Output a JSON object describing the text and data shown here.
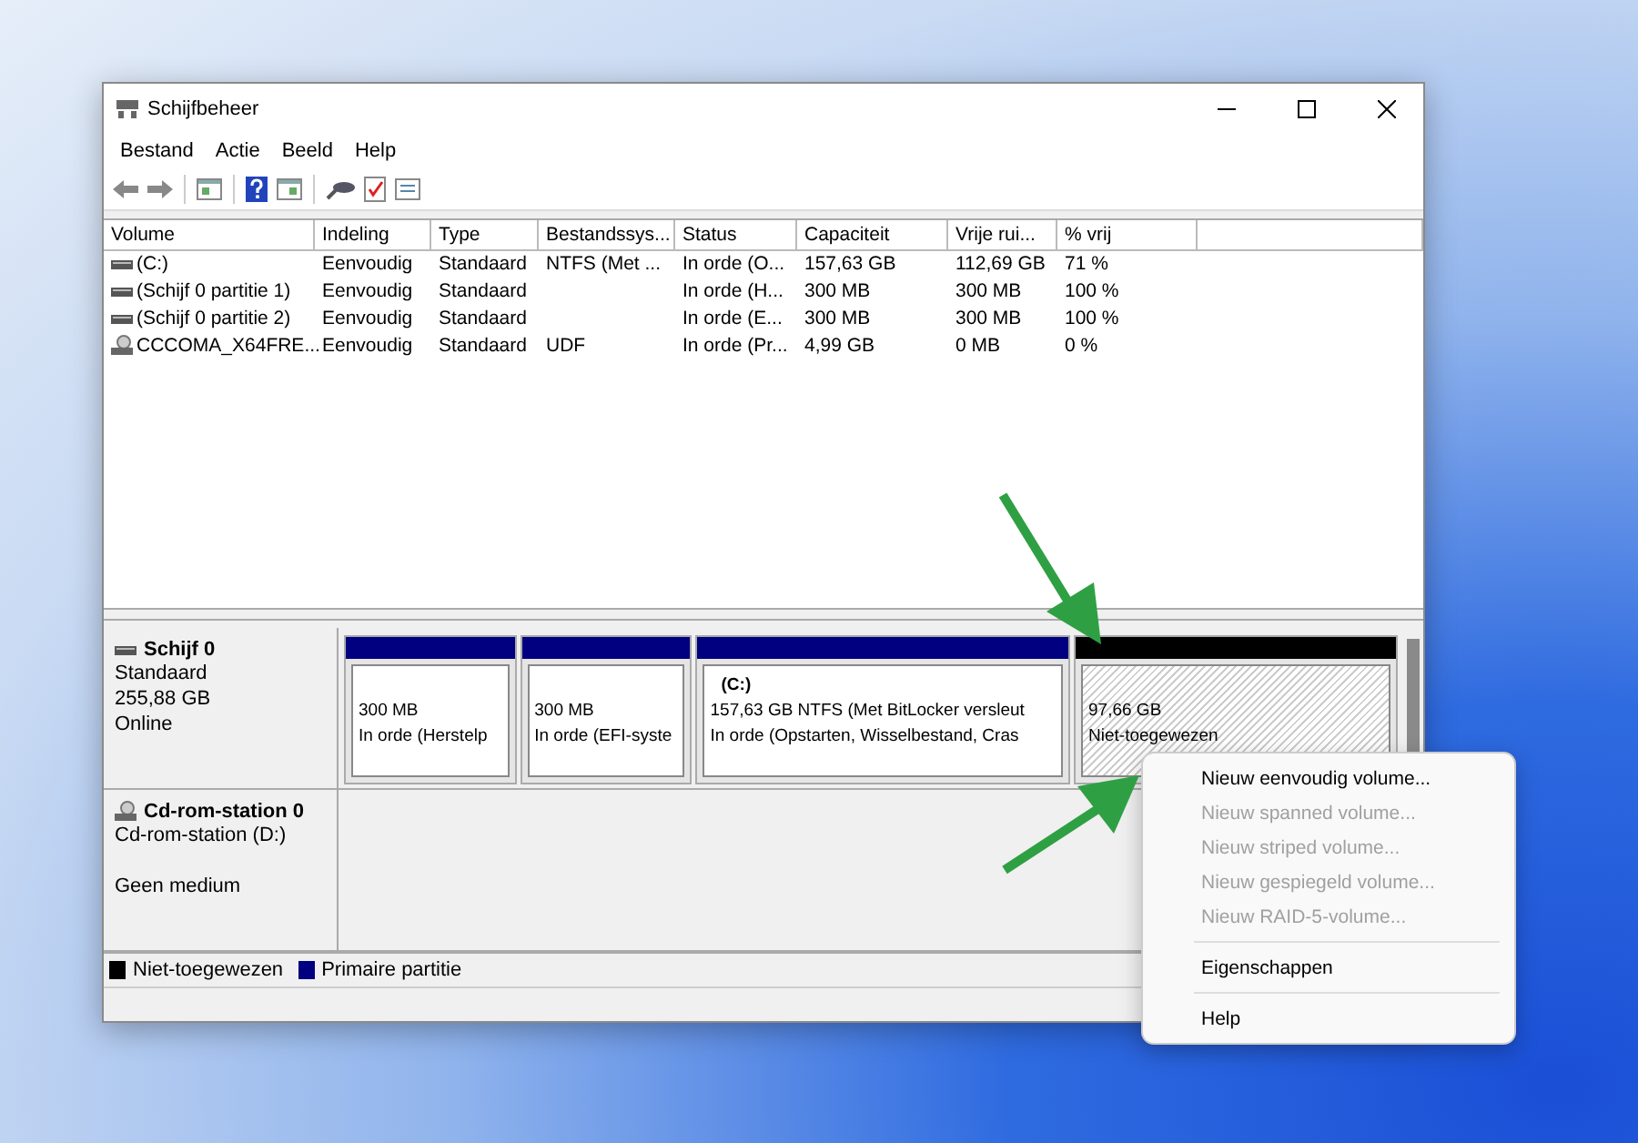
{
  "window": {
    "title": "Schijfbeheer"
  },
  "menu": [
    "Bestand",
    "Actie",
    "Beeld",
    "Help"
  ],
  "table": {
    "columns": [
      "Volume",
      "Indeling",
      "Type",
      "Bestandssys...",
      "Status",
      "Capaciteit",
      "Vrije rui...",
      "% vrij"
    ],
    "rows": [
      {
        "kind": "disk",
        "cells": [
          "(C:)",
          "Eenvoudig",
          "Standaard",
          "NTFS (Met ...",
          "In orde (O...",
          "157,63 GB",
          "112,69 GB",
          "71 %"
        ]
      },
      {
        "kind": "disk",
        "cells": [
          "(Schijf 0 partitie 1)",
          "Eenvoudig",
          "Standaard",
          "",
          "In orde (H...",
          "300 MB",
          "300 MB",
          "100 %"
        ]
      },
      {
        "kind": "disk",
        "cells": [
          "(Schijf 0 partitie 2)",
          "Eenvoudig",
          "Standaard",
          "",
          "In orde (E...",
          "300 MB",
          "300 MB",
          "100 %"
        ]
      },
      {
        "kind": "cdrom",
        "cells": [
          "CCCOMA_X64FRE...",
          "Eenvoudig",
          "Standaard",
          "UDF",
          "In orde (Pr...",
          "4,99 GB",
          "0 MB",
          "0 %"
        ]
      }
    ]
  },
  "disks": [
    {
      "kind": "disk",
      "name": "Schijf 0",
      "lines": [
        "Standaard",
        "255,88 GB",
        "Online"
      ],
      "partitions": [
        {
          "kind": "primary",
          "size": "300 MB",
          "status": "In orde (Herstelp"
        },
        {
          "kind": "primary",
          "size": "300 MB",
          "status": "In orde (EFI-syste"
        },
        {
          "kind": "primary",
          "title": "(C:)",
          "size": "157,63 GB NTFS (Met BitLocker versleut",
          "status": "In orde (Opstarten, Wisselbestand, Cras"
        },
        {
          "kind": "unallocated",
          "size": "97,66 GB",
          "status": "Niet-toegewezen"
        }
      ]
    },
    {
      "kind": "cdrom",
      "name": "Cd-rom-station 0",
      "lines": [
        "Cd-rom-station (D:)",
        "Geen medium"
      ]
    }
  ],
  "legend": [
    {
      "label": "Niet-toegewezen",
      "color": "#000000"
    },
    {
      "label": "Primaire partitie",
      "color": "#000080"
    }
  ],
  "context_menu": [
    {
      "kind": "item",
      "label": "Nieuw eenvoudig volume...",
      "disabled": false
    },
    {
      "kind": "item",
      "label": "Nieuw spanned volume...",
      "disabled": true
    },
    {
      "kind": "item",
      "label": "Nieuw striped volume...",
      "disabled": true
    },
    {
      "kind": "item",
      "label": "Nieuw gespiegeld volume...",
      "disabled": true
    },
    {
      "kind": "item",
      "label": "Nieuw RAID-5-volume...",
      "disabled": true
    },
    {
      "kind": "separator"
    },
    {
      "kind": "item",
      "label": "Eigenschappen",
      "disabled": false
    },
    {
      "kind": "separator"
    },
    {
      "kind": "item",
      "label": "Help",
      "disabled": false
    }
  ]
}
